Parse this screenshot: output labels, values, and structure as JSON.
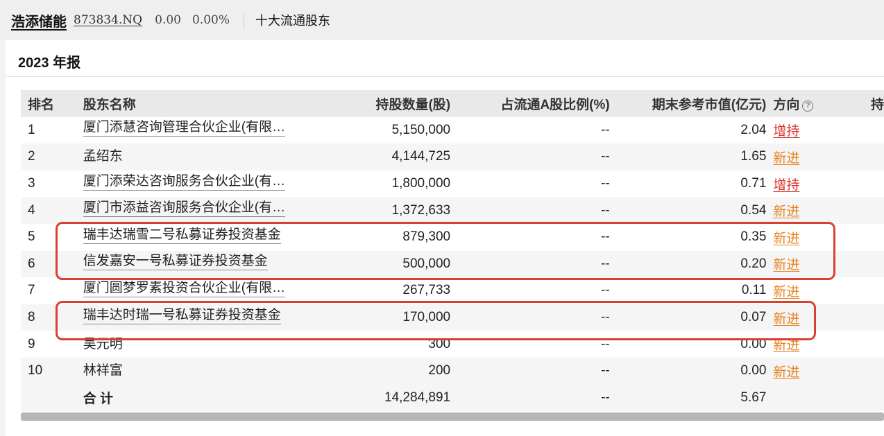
{
  "header": {
    "stock_name": "浩添储能",
    "stock_code": "873834.NQ",
    "price": "0.00",
    "change_pct": "0.00%",
    "section": "十大流通股东"
  },
  "report": {
    "title": "2023 年报"
  },
  "table": {
    "columns": {
      "rank": "排名",
      "name": "股东名称",
      "shares": "持股数量(股)",
      "pct": "占流通A股比例(%)",
      "value": "期末参考市值(亿元)",
      "direction": "方向",
      "more": "持"
    },
    "rows": [
      {
        "rank": "1",
        "name": "厦门添慧咨询管理合伙企业(有限…",
        "shares": "5,150,000",
        "pct": "--",
        "value": "2.04",
        "direction": "增持",
        "dir_type": "inc",
        "linked": true
      },
      {
        "rank": "2",
        "name": "孟绍东",
        "shares": "4,144,725",
        "pct": "--",
        "value": "1.65",
        "direction": "新进",
        "dir_type": "new",
        "linked": false
      },
      {
        "rank": "3",
        "name": "厦门添荣达咨询服务合伙企业(有…",
        "shares": "1,800,000",
        "pct": "--",
        "value": "0.71",
        "direction": "增持",
        "dir_type": "inc",
        "linked": true
      },
      {
        "rank": "4",
        "name": "厦门市添益咨询服务合伙企业(有…",
        "shares": "1,372,633",
        "pct": "--",
        "value": "0.54",
        "direction": "新进",
        "dir_type": "new",
        "linked": true
      },
      {
        "rank": "5",
        "name": "瑞丰达瑞雪二号私募证券投资基金",
        "shares": "879,300",
        "pct": "--",
        "value": "0.35",
        "direction": "新进",
        "dir_type": "new",
        "linked": true
      },
      {
        "rank": "6",
        "name": "信发嘉安一号私募证券投资基金",
        "shares": "500,000",
        "pct": "--",
        "value": "0.20",
        "direction": "新进",
        "dir_type": "new",
        "linked": true
      },
      {
        "rank": "7",
        "name": "厦门圆梦罗素投资合伙企业(有限…",
        "shares": "267,733",
        "pct": "--",
        "value": "0.11",
        "direction": "新进",
        "dir_type": "new",
        "linked": true
      },
      {
        "rank": "8",
        "name": "瑞丰达时瑞一号私募证券投资基金",
        "shares": "170,000",
        "pct": "--",
        "value": "0.07",
        "direction": "新进",
        "dir_type": "new",
        "linked": true
      },
      {
        "rank": "9",
        "name": "吴元明",
        "shares": "300",
        "pct": "--",
        "value": "0.00",
        "direction": "新进",
        "dir_type": "new",
        "linked": false
      },
      {
        "rank": "10",
        "name": "林祥富",
        "shares": "200",
        "pct": "--",
        "value": "0.00",
        "direction": "新进",
        "dir_type": "new",
        "linked": false
      }
    ],
    "total": {
      "label": "合 计",
      "shares": "14,284,891",
      "pct": "--",
      "value": "5.67"
    }
  },
  "colors": {
    "increase": "#d9352f",
    "new_entry": "#e8821e",
    "highlight_box": "#d8412f"
  },
  "icons": {
    "direction_help": "help-circle-icon"
  }
}
